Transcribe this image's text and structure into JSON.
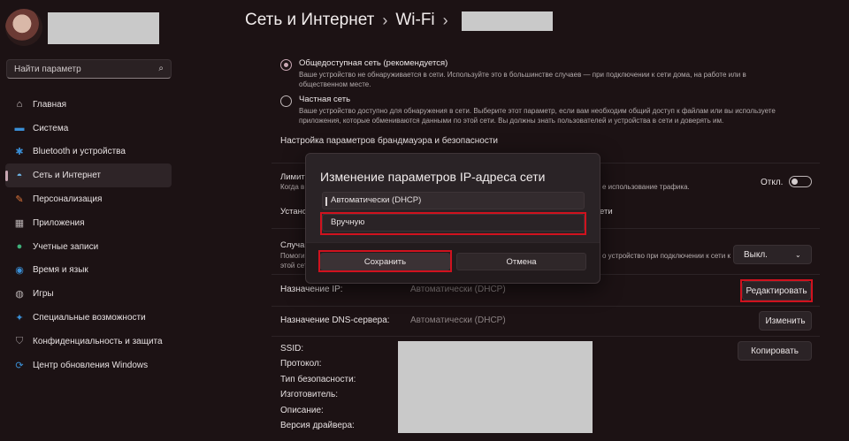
{
  "sidebar": {
    "search_placeholder": "Найти параметр",
    "items": [
      {
        "label": "Главная",
        "icon": "home-icon",
        "glyph": "⌂",
        "color": "#d7cfd0"
      },
      {
        "label": "Система",
        "icon": "monitor-icon",
        "glyph": "▬",
        "color": "#3a8fd6"
      },
      {
        "label": "Bluetooth и устройства",
        "icon": "bluetooth-icon",
        "glyph": "✱",
        "color": "#3a8fd6"
      },
      {
        "label": "Сеть и Интернет",
        "icon": "wifi-icon",
        "glyph": "◓",
        "color": "#6fb6e8"
      },
      {
        "label": "Персонализация",
        "icon": "brush-icon",
        "glyph": "✎",
        "color": "#e0763a"
      },
      {
        "label": "Приложения",
        "icon": "apps-icon",
        "glyph": "▦",
        "color": "#b9b2b3"
      },
      {
        "label": "Учетные записи",
        "icon": "account-icon",
        "glyph": "●",
        "color": "#3fb07a"
      },
      {
        "label": "Время и язык",
        "icon": "globe-icon",
        "glyph": "◉",
        "color": "#3a8fd6"
      },
      {
        "label": "Игры",
        "icon": "gamepad-icon",
        "glyph": "◍",
        "color": "#b9b2b3"
      },
      {
        "label": "Специальные возможности",
        "icon": "accessibility-icon",
        "glyph": "✦",
        "color": "#3a8fd6"
      },
      {
        "label": "Конфиденциальность и защита",
        "icon": "shield-icon",
        "glyph": "⛉",
        "color": "#9a9293"
      },
      {
        "label": "Центр обновления Windows",
        "icon": "update-icon",
        "glyph": "⟳",
        "color": "#3a8fd6"
      }
    ],
    "selected_index": 3
  },
  "breadcrumb": {
    "part1": "Сеть и Интернет",
    "sep": "›",
    "part2": "Wi-Fi",
    "sep2": "›"
  },
  "network_profile": {
    "public": {
      "title": "Общедоступная сеть (рекомендуется)",
      "desc": "Ваше устройство не обнаруживается в сети. Используйте это в большинстве случаев — при подключении к сети дома, на работе или в общественном месте.",
      "selected": true
    },
    "private": {
      "title": "Частная сеть",
      "desc": "Ваше устройство доступно для обнаружения в сети. Выберите этот параметр, если вам необходим общий доступ к файлам или вы используете приложения, которые обмениваются данными по этой сети. Вы должны знать пользователей и устройства в сети и доверять им.",
      "selected": false
    },
    "firewall_link": "Настройка параметров брандмауэра и безопасности"
  },
  "metered": {
    "title_partial": "Лимит",
    "desc_partial": "Когда в",
    "desc_tail": "е использование трафика.",
    "toggle_label": "Откл."
  },
  "data_limit": {
    "title_partial": "Устано",
    "title_tail": "ети"
  },
  "random_addresses": {
    "title_partial": "Случай",
    "desc_line1_partial": "Помоги",
    "desc_line1_tail": "о устройство при подключении к сети к",
    "desc_line2_partial": "этой сети",
    "select_value": "Выкл."
  },
  "ip_assignment": {
    "label": "Назначение IP:",
    "value": "Автоматически (DHCP)",
    "button": "Редактировать"
  },
  "dns_assignment": {
    "label": "Назначение DNS-сервера:",
    "value": "Автоматически (DHCP)",
    "button": "Изменить"
  },
  "properties": {
    "labels": [
      "SSID:",
      "Протокол:",
      "Тип безопасности:",
      "Изготовитель:",
      "Описание:",
      "Версия драйвера:"
    ],
    "copy_button": "Копировать"
  },
  "dialog": {
    "title": "Изменение параметров IP-адреса сети",
    "option_auto": "Автоматически (DHCP)",
    "option_manual": "Вручную",
    "save": "Сохранить",
    "cancel": "Отмена"
  },
  "colors": {
    "highlight_red": "#d0121e",
    "accent": "#caa8b5",
    "background": "#1c1214"
  }
}
